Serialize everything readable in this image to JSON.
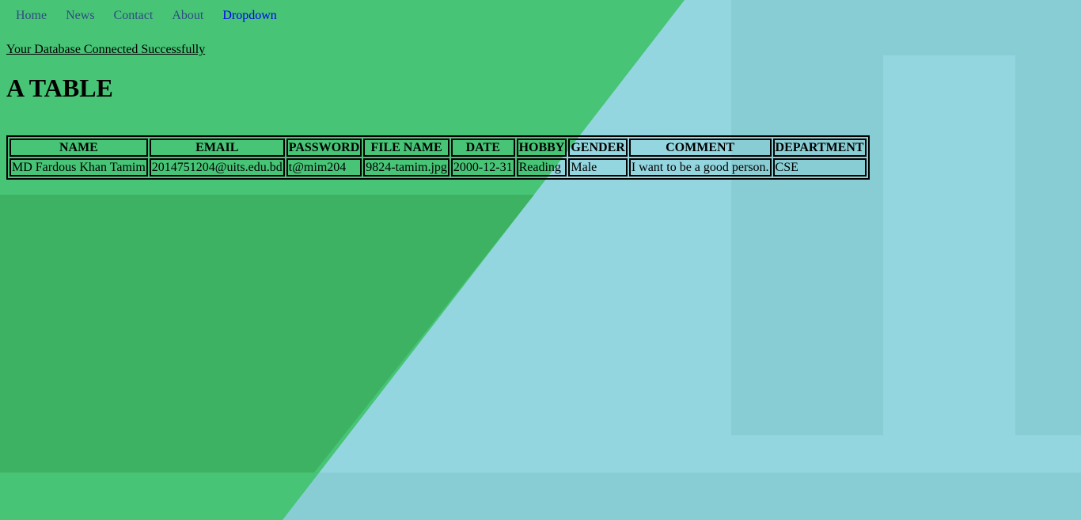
{
  "nav": {
    "items": [
      "Home",
      "News",
      "Contact",
      "About"
    ],
    "dropdown_label": "Dropdown"
  },
  "status_text": "Your Database Connected Successfully",
  "heading": "A TABLE",
  "table": {
    "headers": [
      "NAME",
      "EMAIL",
      "PASSWORD",
      "FILE NAME",
      "DATE",
      "HOBBY",
      "GENDER",
      "COMMENT",
      "DEPARTMENT"
    ],
    "rows": [
      [
        "MD Fardous Khan Tamim",
        "2014751204@uits.edu.bd",
        "t@mim204",
        "9824-tamim.jpg",
        "2000-12-31",
        "Reading",
        "Male",
        "I want to be a good person.",
        "CSE"
      ]
    ]
  },
  "colors": {
    "green": "#47c476",
    "green_dark": "#3db262",
    "blue": "#94d6df",
    "blue_dark": "#89cdd4",
    "nav_link": "#2f4d80",
    "dropdown_link": "#0000ee"
  }
}
